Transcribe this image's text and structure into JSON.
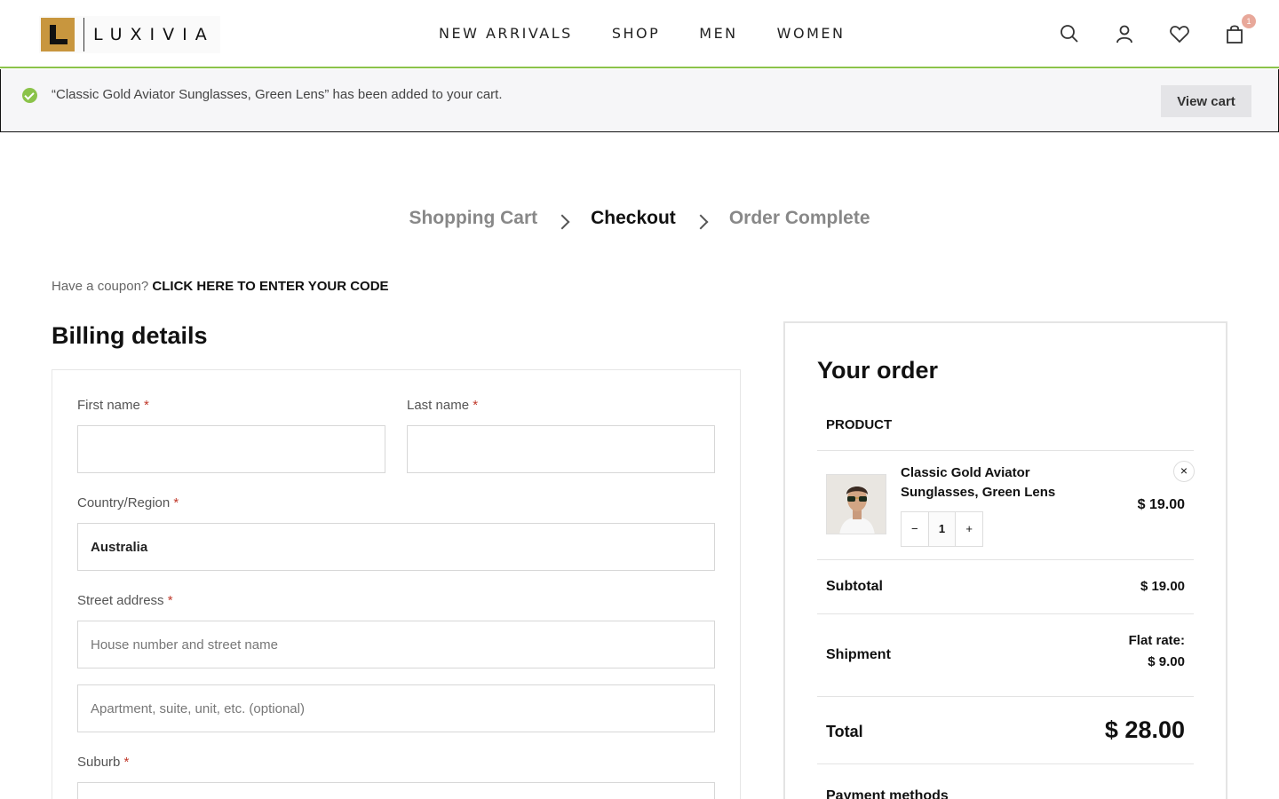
{
  "brand": {
    "name": "LUXIVIA",
    "accent": "#c8963e"
  },
  "nav": [
    "NEW ARRIVALS",
    "SHOP",
    "MEN",
    "WOMEN"
  ],
  "header_icons": [
    "search-icon",
    "user-icon",
    "heart-icon",
    "bag-icon"
  ],
  "cart_count": "1",
  "notice": {
    "text": "“Classic Gold Aviator Sunglasses, Green Lens” has been added to your cart.",
    "button": "View cart",
    "status_color": "#8bc34a"
  },
  "steps": [
    {
      "label": "Shopping Cart",
      "active": false
    },
    {
      "label": "Checkout",
      "active": true
    },
    {
      "label": "Order Complete",
      "active": false
    }
  ],
  "coupon": {
    "prompt": "Have a coupon?",
    "link": "Click here to enter your code"
  },
  "billing": {
    "title": "Billing details",
    "first_name_label": "First name",
    "last_name_label": "Last name",
    "country_label": "Country/Region",
    "country_value": "Australia",
    "street_label": "Street address",
    "street_placeholder": "House number and street name",
    "apartment_placeholder": "Apartment, suite, unit, etc. (optional)",
    "suburb_label": "Suburb",
    "required_mark": "*"
  },
  "order": {
    "title": "Your order",
    "product_header": "PRODUCT",
    "item": {
      "name": "Classic Gold Aviator Sunglasses, Green Lens",
      "price": "$ 19.00",
      "qty": "1",
      "minus": "−",
      "plus": "+",
      "remove": "×"
    },
    "subtotal_label": "Subtotal",
    "subtotal_value": "$ 19.00",
    "shipment_label": "Shipment",
    "shipment_rate": "Flat rate:",
    "shipment_value": "$ 9.00",
    "total_label": "Total",
    "total_value": "$ 28.00",
    "payment_label": "Payment methods"
  }
}
